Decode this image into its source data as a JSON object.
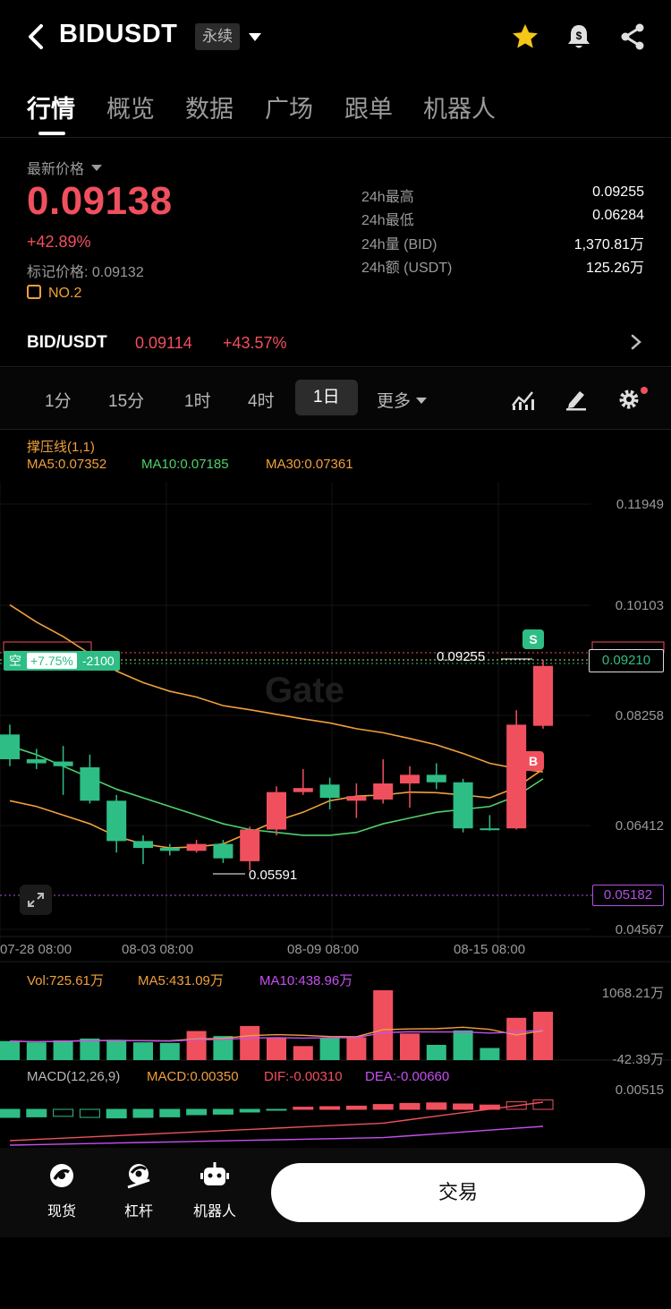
{
  "header": {
    "symbol": "BIDUSDT",
    "contract_type": "永续"
  },
  "tabs": [
    "行情",
    "概览",
    "数据",
    "广场",
    "跟单",
    "机器人"
  ],
  "price": {
    "label": "最新价格",
    "last": "0.09138",
    "change": "+42.89%",
    "mark_price": "标记价格: 0.09132",
    "rank": "NO.2",
    "stats": [
      {
        "label": "24h最高",
        "value": "0.09255"
      },
      {
        "label": "24h最低",
        "value": "0.06284"
      },
      {
        "label": "24h量 (BID)",
        "value": "1,370.81万"
      },
      {
        "label": "24h额 (USDT)",
        "value": "125.26万"
      }
    ]
  },
  "spot_pair": {
    "symbol": "BID/USDT",
    "price": "0.09114",
    "change": "+43.57%"
  },
  "intervals": [
    "1分",
    "15分",
    "1时",
    "4时",
    "1日",
    "更多"
  ],
  "selected_interval": "1日",
  "chart": {
    "indicator": "撑压线(1,1)",
    "ma5": "MA5:0.07352",
    "ma10": "MA10:0.07185",
    "ma30": "MA30:0.07361",
    "y_ticks": [
      "0.11949",
      "0.10103",
      "0.08258",
      "0.06412",
      "0.04567"
    ],
    "x_ticks": [
      "07-28 08:00",
      "08-03 08:00",
      "08-09 08:00",
      "08-15 08:00"
    ],
    "position_side": "空",
    "position_pnl": "+7.75%",
    "position_size": "-2100",
    "high_label": "0.09255",
    "low_label": "0.05591",
    "current_price_box": "0.09210",
    "liq_price_box": "0.05182",
    "marker_s": "S",
    "marker_b": "B",
    "watermark": "Gate",
    "vol": "Vol:725.61万",
    "vol_ma5": "MA5:431.09万",
    "vol_ma10": "MA10:438.96万",
    "vol_top": "1068.21万",
    "vol_bottom": "-42.39万",
    "macd_title": "MACD(12,26,9)",
    "macd": "MACD:0.00350",
    "dif": "DIF:-0.00310",
    "dea": "DEA:-0.00660",
    "macd_top": "0.00515"
  },
  "chart_data": {
    "type": "candlestick",
    "y_range": [
      0.04567,
      0.11949
    ],
    "candles": [
      {
        "o": 0.0795,
        "h": 0.0812,
        "l": 0.074,
        "c": 0.0752
      },
      {
        "o": 0.0752,
        "h": 0.077,
        "l": 0.0735,
        "c": 0.0745
      },
      {
        "o": 0.0748,
        "h": 0.0775,
        "l": 0.069,
        "c": 0.074
      },
      {
        "o": 0.0738,
        "h": 0.076,
        "l": 0.0675,
        "c": 0.068
      },
      {
        "o": 0.068,
        "h": 0.069,
        "l": 0.059,
        "c": 0.061
      },
      {
        "o": 0.061,
        "h": 0.062,
        "l": 0.057,
        "c": 0.0598
      },
      {
        "o": 0.0598,
        "h": 0.0605,
        "l": 0.0585,
        "c": 0.0593
      },
      {
        "o": 0.0593,
        "h": 0.0612,
        "l": 0.059,
        "c": 0.0605
      },
      {
        "o": 0.0605,
        "h": 0.0612,
        "l": 0.0572,
        "c": 0.058
      },
      {
        "o": 0.0575,
        "h": 0.0635,
        "l": 0.0559,
        "c": 0.063
      },
      {
        "o": 0.063,
        "h": 0.0705,
        "l": 0.062,
        "c": 0.0695
      },
      {
        "o": 0.0695,
        "h": 0.0735,
        "l": 0.069,
        "c": 0.0702
      },
      {
        "o": 0.0708,
        "h": 0.072,
        "l": 0.0665,
        "c": 0.0685
      },
      {
        "o": 0.068,
        "h": 0.071,
        "l": 0.065,
        "c": 0.0688
      },
      {
        "o": 0.0682,
        "h": 0.0752,
        "l": 0.0675,
        "c": 0.071
      },
      {
        "o": 0.071,
        "h": 0.074,
        "l": 0.0668,
        "c": 0.0725
      },
      {
        "o": 0.0725,
        "h": 0.0745,
        "l": 0.07,
        "c": 0.0712
      },
      {
        "o": 0.0712,
        "h": 0.0718,
        "l": 0.0625,
        "c": 0.0632
      },
      {
        "o": 0.0632,
        "h": 0.0655,
        "l": 0.0628,
        "c": 0.063
      },
      {
        "o": 0.0632,
        "h": 0.0837,
        "l": 0.063,
        "c": 0.0812
      },
      {
        "o": 0.081,
        "h": 0.0925,
        "l": 0.0805,
        "c": 0.0914
      }
    ],
    "ma5_line": [
      0.068,
      0.067,
      0.0655,
      0.064,
      0.0618,
      0.0605,
      0.0598,
      0.06,
      0.0605,
      0.0625,
      0.0645,
      0.066,
      0.068,
      0.0688,
      0.069,
      0.0695,
      0.0694,
      0.069,
      0.0685,
      0.0703,
      0.0735
    ],
    "ma10_line": [
      0.0775,
      0.076,
      0.074,
      0.072,
      0.07,
      0.0685,
      0.067,
      0.0655,
      0.064,
      0.063,
      0.0625,
      0.062,
      0.062,
      0.0625,
      0.064,
      0.065,
      0.066,
      0.0665,
      0.067,
      0.0688,
      0.0718
    ],
    "ma30_line": [
      0.102,
      0.099,
      0.0965,
      0.0935,
      0.0905,
      0.0885,
      0.087,
      0.086,
      0.0845,
      0.0838,
      0.083,
      0.0822,
      0.0815,
      0.0805,
      0.0798,
      0.0788,
      0.0777,
      0.0762,
      0.0745,
      0.0736,
      0.073
    ],
    "volume": [
      260,
      240,
      270,
      300,
      280,
      240,
      230,
      420,
      340,
      500,
      320,
      180,
      320,
      320,
      1068,
      380,
      200,
      430,
      150,
      630,
      726
    ],
    "volume_range": [
      -42.39,
      1068.21
    ],
    "macd_hist": [
      -0.003,
      -0.0028,
      -0.0026,
      -0.003,
      -0.0032,
      -0.003,
      -0.0028,
      -0.002,
      -0.0018,
      -0.001,
      -0.0002,
      0.0008,
      0.001,
      0.0012,
      0.0018,
      0.0022,
      0.0024,
      0.002,
      0.0016,
      0.0028,
      0.0035
    ]
  },
  "colors": {
    "up": "#f0505e",
    "down": "#2ebd85",
    "ma5": "#f0a03c",
    "ma10": "#4fd06a",
    "ma30": "#f0a03c",
    "vol_ma10": "#c650f0"
  },
  "bottom_nav": {
    "items": [
      "现货",
      "杠杆",
      "机器人"
    ],
    "trade": "交易"
  }
}
